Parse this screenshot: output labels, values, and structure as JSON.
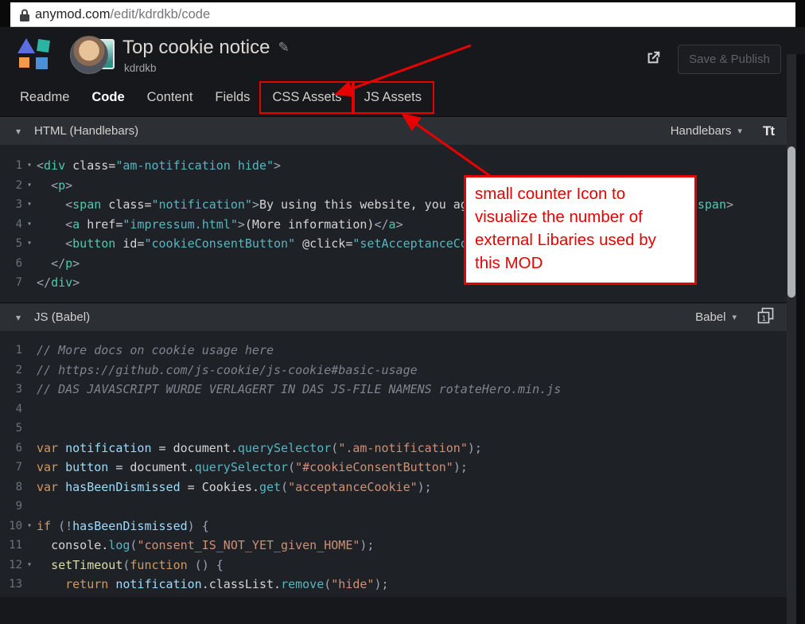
{
  "browser": {
    "url_host": "anymod.com",
    "url_path": "/edit/kdrdkb/code"
  },
  "header": {
    "title": "Top cookie notice",
    "subtitle": "kdrdkb",
    "save_button": "Save & Publish"
  },
  "tabs": [
    {
      "label": "Readme"
    },
    {
      "label": "Code",
      "active": true
    },
    {
      "label": "Content"
    },
    {
      "label": "Fields"
    },
    {
      "label": "CSS Assets",
      "highlighted": true
    },
    {
      "label": "JS Assets",
      "highlighted": true
    }
  ],
  "glyphs": {
    "caret": "▾",
    "chevron": "▾",
    "pencil": "✎",
    "fold": "▾",
    "font_size": "Tt"
  },
  "annotation": {
    "text": "small counter Icon to visualize the number of external Libaries used by this MOD"
  },
  "html_section": {
    "title": "HTML (Handlebars)",
    "mode": "Handlebars",
    "lines": [
      {
        "n": 1,
        "fold": true,
        "tokens": [
          {
            "t": "<",
            "c": "p"
          },
          {
            "t": "div",
            "c": "tag"
          },
          {
            "t": " class=",
            "c": "txt"
          },
          {
            "t": "\"am-notification hide\"",
            "c": "str"
          },
          {
            "t": ">",
            "c": "p"
          }
        ]
      },
      {
        "n": 2,
        "fold": true,
        "tokens": [
          {
            "t": "  ",
            "c": "txt"
          },
          {
            "t": "<",
            "c": "p"
          },
          {
            "t": "p",
            "c": "tag"
          },
          {
            "t": ">",
            "c": "p"
          }
        ]
      },
      {
        "n": 3,
        "fold": true,
        "tokens": [
          {
            "t": "    ",
            "c": "txt"
          },
          {
            "t": "<",
            "c": "p"
          },
          {
            "t": "span",
            "c": "tag"
          },
          {
            "t": " class=",
            "c": "txt"
          },
          {
            "t": "\"notification\"",
            "c": "str"
          },
          {
            "t": ">",
            "c": "p"
          },
          {
            "t": "By using this website, you agr",
            "c": "txt"
          },
          {
            "t": "                               ",
            "c": "txt"
          },
          {
            "t": "span",
            "c": "tag"
          },
          {
            "t": ">",
            "c": "p"
          }
        ]
      },
      {
        "n": 4,
        "fold": true,
        "tokens": [
          {
            "t": "    ",
            "c": "txt"
          },
          {
            "t": "<",
            "c": "p"
          },
          {
            "t": "a",
            "c": "tag"
          },
          {
            "t": " href=",
            "c": "txt"
          },
          {
            "t": "\"impressum.html\"",
            "c": "str"
          },
          {
            "t": ">",
            "c": "p"
          },
          {
            "t": "(More information)",
            "c": "txt"
          },
          {
            "t": "</",
            "c": "p"
          },
          {
            "t": "a",
            "c": "tag"
          },
          {
            "t": ">",
            "c": "p"
          }
        ]
      },
      {
        "n": 5,
        "fold": true,
        "tokens": [
          {
            "t": "    ",
            "c": "txt"
          },
          {
            "t": "<",
            "c": "p"
          },
          {
            "t": "button",
            "c": "tag"
          },
          {
            "t": " id=",
            "c": "txt"
          },
          {
            "t": "\"cookieConsentButton\"",
            "c": "str"
          },
          {
            "t": " @click=",
            "c": "txt"
          },
          {
            "t": "\"setAcceptanceCoo",
            "c": "str"
          }
        ]
      },
      {
        "n": 6,
        "tokens": [
          {
            "t": "  ",
            "c": "txt"
          },
          {
            "t": "</",
            "c": "p"
          },
          {
            "t": "p",
            "c": "tag"
          },
          {
            "t": ">",
            "c": "p"
          }
        ]
      },
      {
        "n": 7,
        "tokens": [
          {
            "t": "</",
            "c": "p"
          },
          {
            "t": "div",
            "c": "tag"
          },
          {
            "t": ">",
            "c": "p"
          }
        ]
      }
    ]
  },
  "js_section": {
    "title": "JS (Babel)",
    "mode": "Babel",
    "badge": "1",
    "lines": [
      {
        "n": 1,
        "tokens": [
          {
            "t": "// More docs on cookie usage here",
            "c": "com"
          }
        ]
      },
      {
        "n": 2,
        "tokens": [
          {
            "t": "// https://github.com/js-cookie/js-cookie#basic-usage",
            "c": "com"
          }
        ]
      },
      {
        "n": 3,
        "tokens": [
          {
            "t": "// DAS JAVASCRIPT WURDE VERLAGERT IN DAS JS-FILE NAMENS rotateHero.min.js",
            "c": "com"
          }
        ]
      },
      {
        "n": 4,
        "tokens": []
      },
      {
        "n": 5,
        "tokens": []
      },
      {
        "n": 6,
        "tokens": [
          {
            "t": "var",
            "c": "kw"
          },
          {
            "t": " ",
            "c": "txt"
          },
          {
            "t": "notification",
            "c": "var"
          },
          {
            "t": " = ",
            "c": "txt"
          },
          {
            "t": "document",
            "c": "txt"
          },
          {
            "t": ".",
            "c": "txt"
          },
          {
            "t": "querySelector",
            "c": "cyan"
          },
          {
            "t": "(",
            "c": "p"
          },
          {
            "t": "\".am-notification\"",
            "c": "jstr"
          },
          {
            "t": ");",
            "c": "p"
          }
        ]
      },
      {
        "n": 7,
        "tokens": [
          {
            "t": "var",
            "c": "kw"
          },
          {
            "t": " ",
            "c": "txt"
          },
          {
            "t": "button",
            "c": "var"
          },
          {
            "t": " = ",
            "c": "txt"
          },
          {
            "t": "document",
            "c": "txt"
          },
          {
            "t": ".",
            "c": "txt"
          },
          {
            "t": "querySelector",
            "c": "cyan"
          },
          {
            "t": "(",
            "c": "p"
          },
          {
            "t": "\"#cookieConsentButton\"",
            "c": "jstr"
          },
          {
            "t": ");",
            "c": "p"
          }
        ]
      },
      {
        "n": 8,
        "tokens": [
          {
            "t": "var",
            "c": "kw"
          },
          {
            "t": " ",
            "c": "txt"
          },
          {
            "t": "hasBeenDismissed",
            "c": "var"
          },
          {
            "t": " = ",
            "c": "txt"
          },
          {
            "t": "Cookies",
            "c": "txt"
          },
          {
            "t": ".",
            "c": "txt"
          },
          {
            "t": "get",
            "c": "cyan"
          },
          {
            "t": "(",
            "c": "p"
          },
          {
            "t": "\"acceptanceCookie\"",
            "c": "jstr"
          },
          {
            "t": ");",
            "c": "p"
          }
        ]
      },
      {
        "n": 9,
        "tokens": []
      },
      {
        "n": 10,
        "fold": true,
        "tokens": [
          {
            "t": "if",
            "c": "kw"
          },
          {
            "t": " (!",
            "c": "p"
          },
          {
            "t": "hasBeenDismissed",
            "c": "var"
          },
          {
            "t": ") {",
            "c": "p"
          }
        ]
      },
      {
        "n": 11,
        "tokens": [
          {
            "t": "  ",
            "c": "txt"
          },
          {
            "t": "console",
            "c": "txt"
          },
          {
            "t": ".",
            "c": "txt"
          },
          {
            "t": "log",
            "c": "cyan"
          },
          {
            "t": "(",
            "c": "p"
          },
          {
            "t": "\"consent_IS_NOT_YET_given_HOME\"",
            "c": "jstr"
          },
          {
            "t": ");",
            "c": "p"
          }
        ]
      },
      {
        "n": 12,
        "fold": true,
        "tokens": [
          {
            "t": "  ",
            "c": "txt"
          },
          {
            "t": "setTimeout",
            "c": "fn"
          },
          {
            "t": "(",
            "c": "p"
          },
          {
            "t": "function",
            "c": "kw"
          },
          {
            "t": " () {",
            "c": "p"
          }
        ]
      },
      {
        "n": 13,
        "tokens": [
          {
            "t": "    ",
            "c": "txt"
          },
          {
            "t": "return",
            "c": "kw"
          },
          {
            "t": " ",
            "c": "txt"
          },
          {
            "t": "notification",
            "c": "var"
          },
          {
            "t": ".",
            "c": "txt"
          },
          {
            "t": "classList",
            "c": "txt"
          },
          {
            "t": ".",
            "c": "txt"
          },
          {
            "t": "remove",
            "c": "cyan"
          },
          {
            "t": "(",
            "c": "p"
          },
          {
            "t": "\"hide\"",
            "c": "jstr"
          },
          {
            "t": ");",
            "c": "p"
          }
        ]
      }
    ]
  },
  "colors": {
    "annotation_red": "#e60000",
    "tag_teal": "#4ec9b0",
    "html_string_cyan": "#56b6c2",
    "keyword_orange": "#d19a66",
    "js_string_orange": "#ce9178",
    "variable_blue": "#9cdcfe",
    "function_yellow": "#dcdcaa",
    "comment_gray": "#7f848e",
    "editor_bg": "#1e2126",
    "section_header_bg": "#2c2f34",
    "header_bg": "#17181b"
  }
}
